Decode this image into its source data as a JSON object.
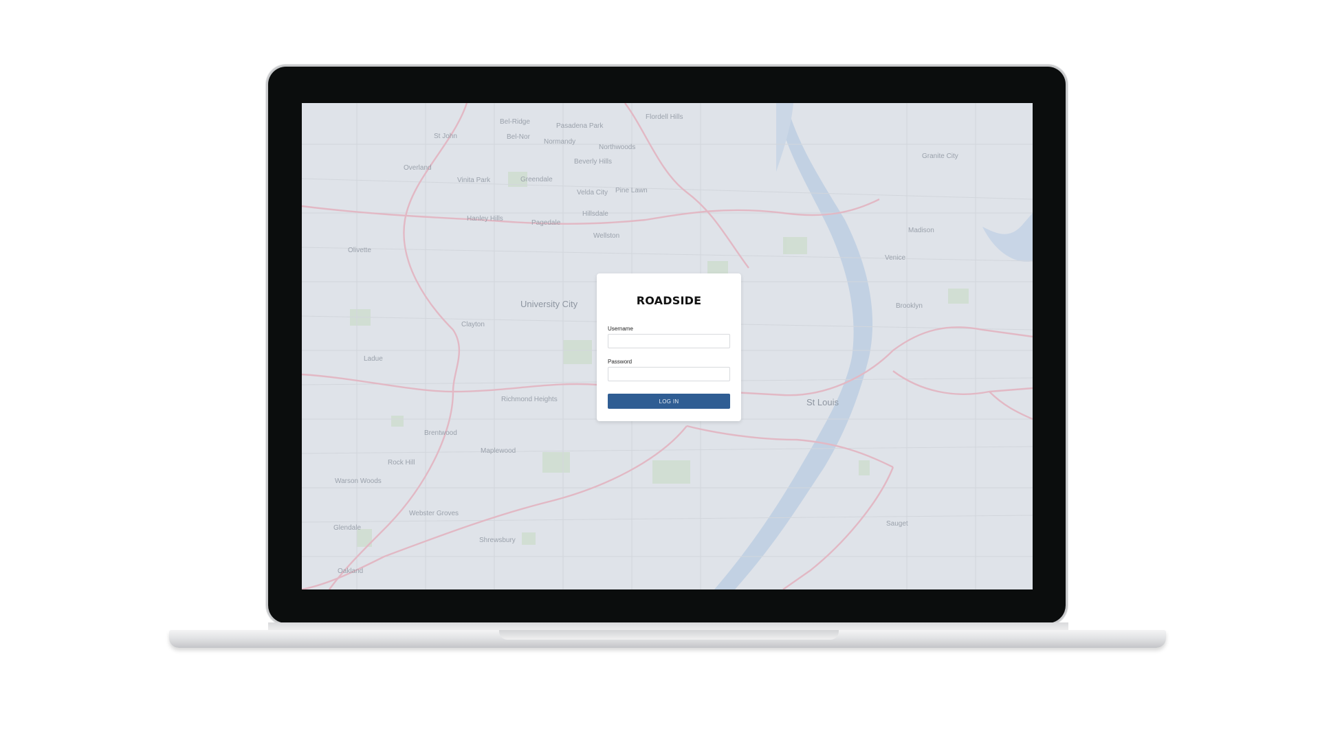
{
  "app": {
    "title": "ROADSIDE"
  },
  "login": {
    "username_label": "Username",
    "password_label": "Password",
    "login_button": "LOG IN"
  },
  "map": {
    "labels": [
      "Bel-Ridge",
      "Pasadena Park",
      "Flordell Hills",
      "St John",
      "Bel-Nor",
      "Normandy",
      "Northwoods",
      "Overland",
      "Vinita Park",
      "Greendale",
      "Beverly Hills",
      "Velda City",
      "Pine Lawn",
      "Hillsdale",
      "Hanley Hills",
      "Pagedale",
      "Wellston",
      "Olivette",
      "University City",
      "Clayton",
      "Ladue",
      "Richmond Heights",
      "Brentwood",
      "Maplewood",
      "Rock Hill",
      "Warson Woods",
      "Webster Groves",
      "Glendale",
      "Shrewsbury",
      "Oakland",
      "St Louis",
      "Granite City",
      "Madison",
      "Venice",
      "Brooklyn",
      "Sauget"
    ]
  }
}
